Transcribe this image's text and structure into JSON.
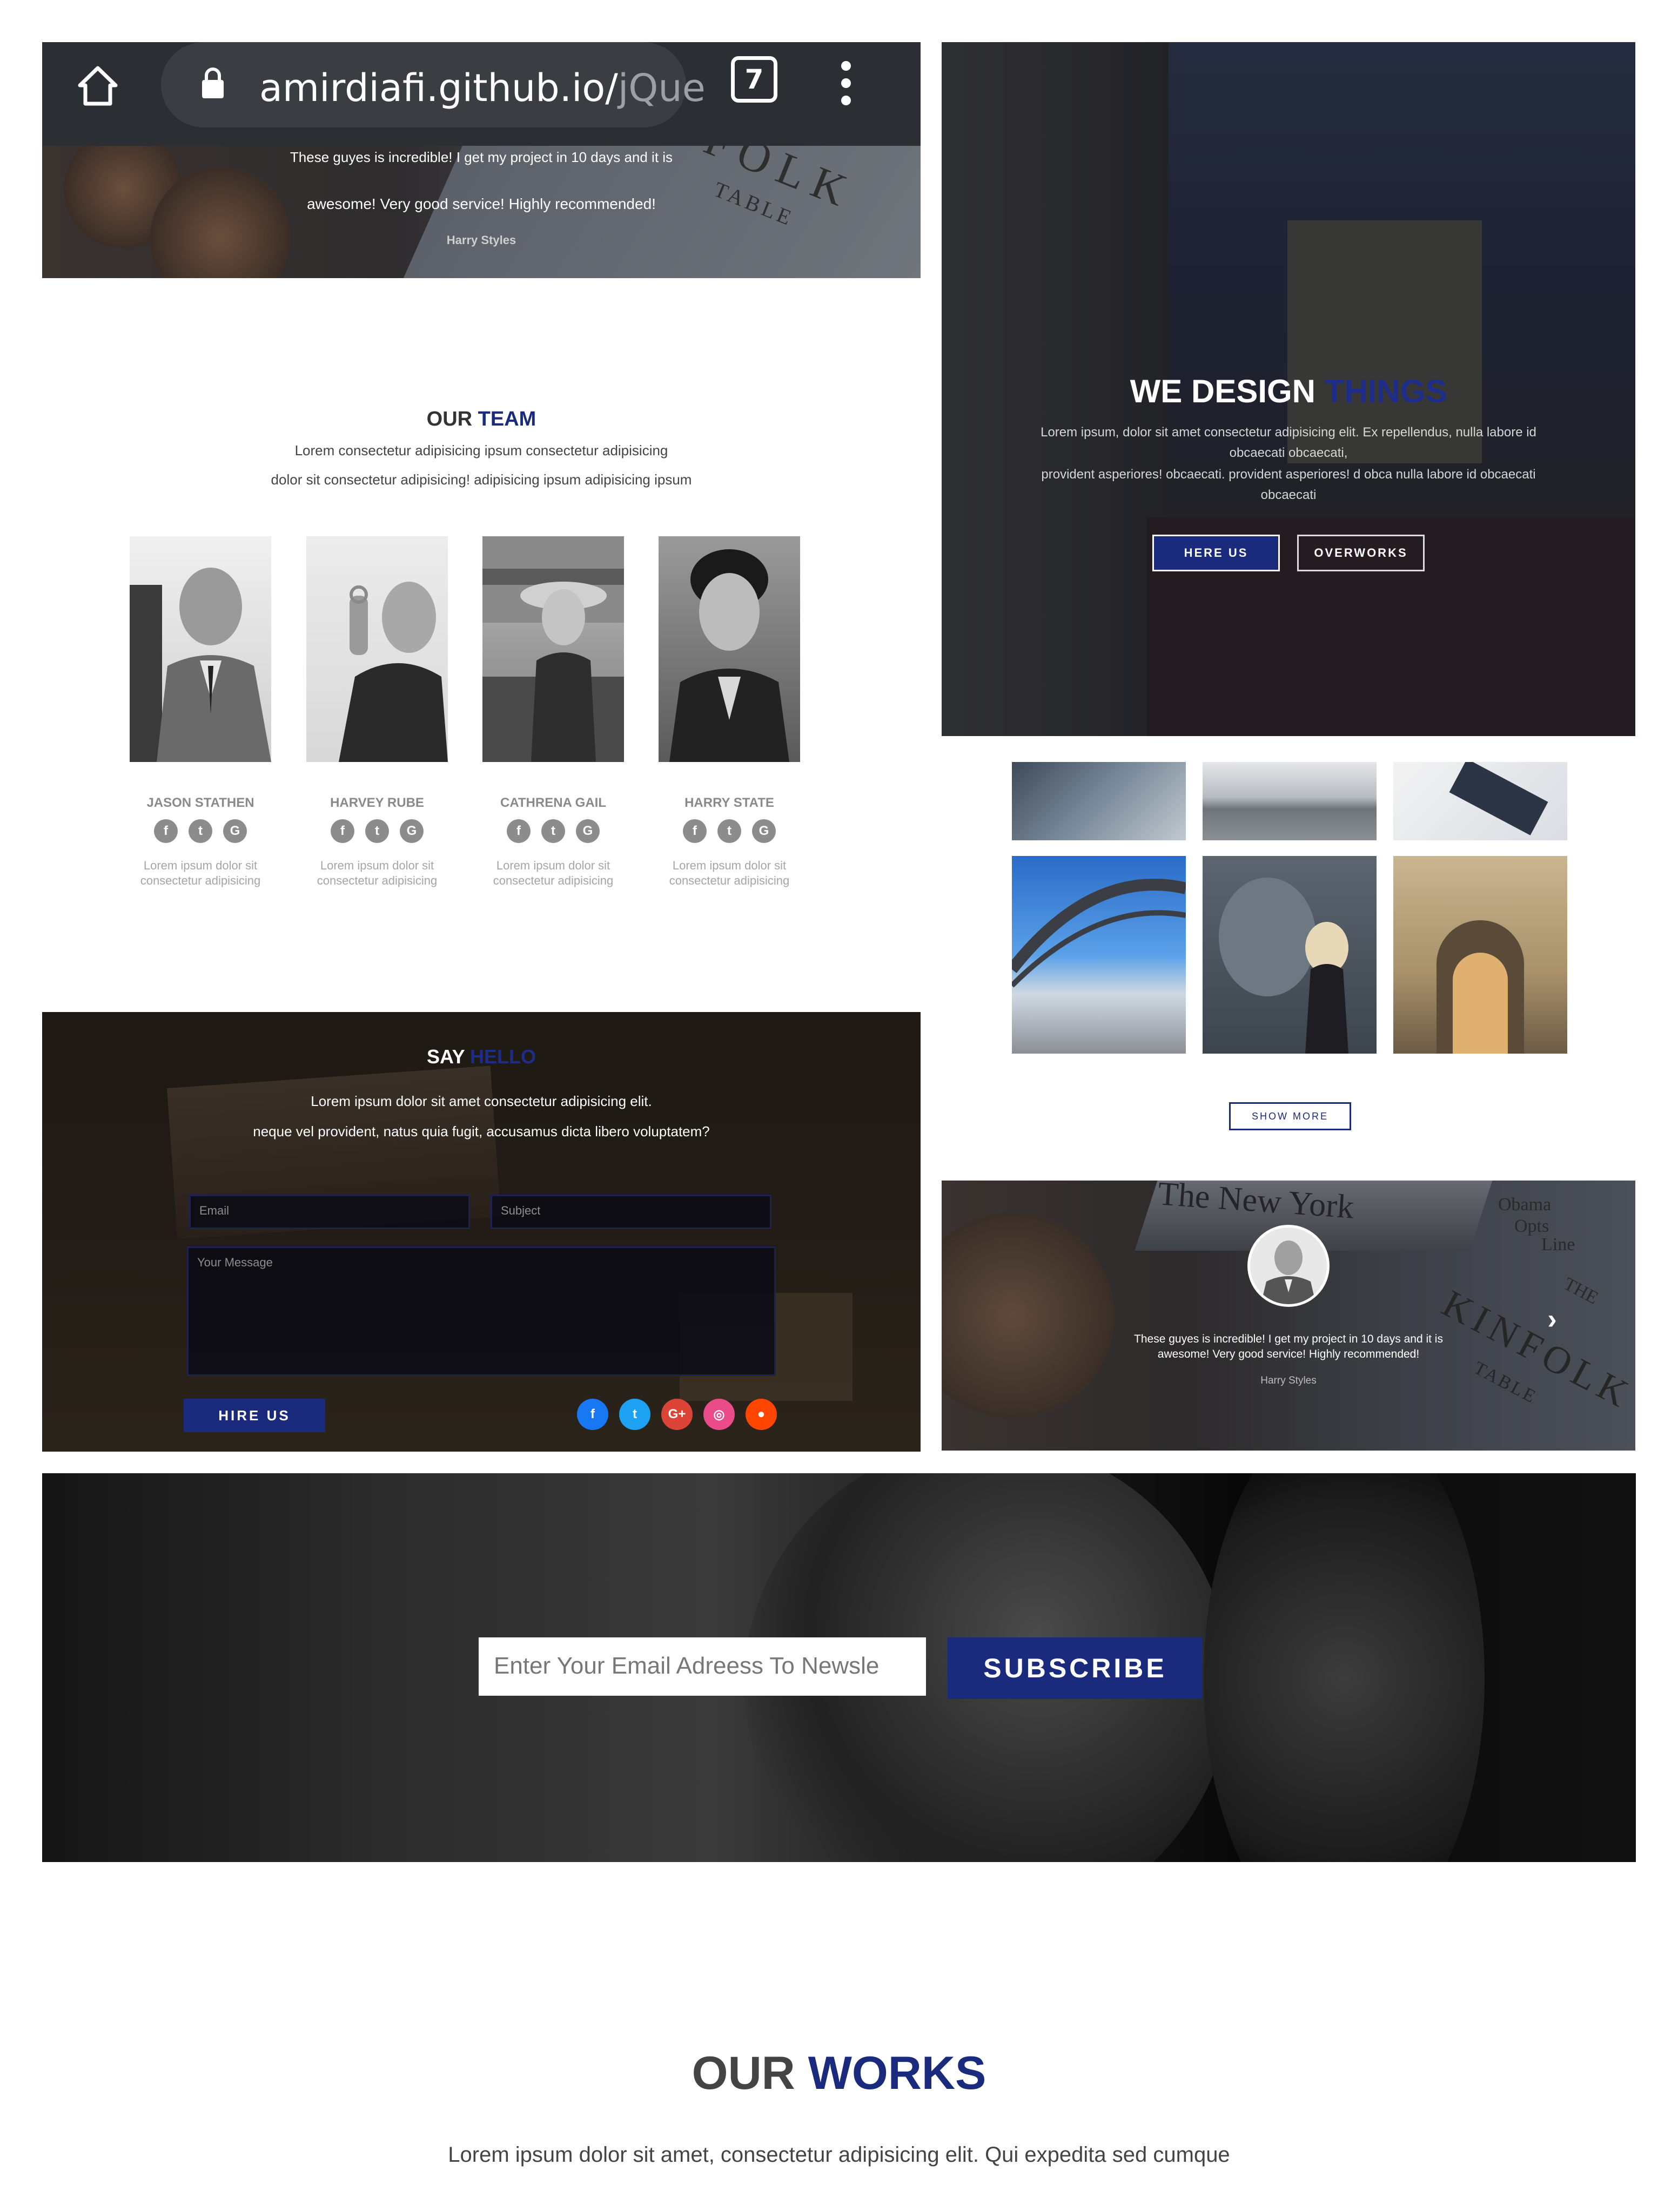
{
  "browser": {
    "url_host": "amirdiafi.github.io/",
    "url_path": "jQue",
    "tab_count": "7"
  },
  "testimonial_top": {
    "quote_partial": "These guyes is incredible! I get my project in 10 days and it is",
    "quote_line2": "awesome! Very good service! Highly recommended!",
    "author": "Harry Styles",
    "magazine_text": "FOLK",
    "magazine_text2": "TABLE"
  },
  "team": {
    "title_a": "OUR",
    "title_b": "TEAM",
    "subtitle_line1": "Lorem consectetur adipisicing ipsum consectetur adipisicing",
    "subtitle_line2": "dolor sit consectetur adipisicing! adipisicing ipsum adipisicing ipsum",
    "members": [
      {
        "name": "JASON STATHEN",
        "desc": "Lorem ipsum dolor sit consectetur adipisicing"
      },
      {
        "name": "HARVEY RUBE",
        "desc": "Lorem ipsum dolor sit consectetur adipisicing"
      },
      {
        "name": "CATHRENA GAIL",
        "desc": "Lorem ipsum dolor sit consectetur adipisicing"
      },
      {
        "name": "HARRY STATE",
        "desc": "Lorem ipsum dolor sit consectetur adipisicing"
      }
    ],
    "icon_facebook": "f",
    "icon_twitter": "t",
    "icon_google": "G",
    "dot_count": 4
  },
  "hero": {
    "title_a": "WE DESIGN",
    "title_b": "THINGS",
    "text_line1": "Lorem ipsum, dolor sit amet consectetur adipisicing elit. Ex repellendus, nulla labore id obcaecati obcaecati,",
    "text_line2": "provident asperiores! obcaecati. provident asperiores! d obca nulla labore id obcaecati obcaecati",
    "btn_primary": "HERE US",
    "btn_secondary": "OVERWORKS"
  },
  "gallery": {
    "show_more": "SHOW MORE"
  },
  "testimonial": {
    "quote_line1": "These guyes is incredible! I get my project in 10 days and it is",
    "quote_line2": "awesome! Very good service! Highly recommended!",
    "author": "Harry Styles",
    "next_icon": "›",
    "paper_title": "The New York",
    "paper_side1": "Obama",
    "paper_side2": "Opts",
    "paper_side3": "Line",
    "mag_the": "THE",
    "mag_kinfolk": "KINFOLK",
    "mag_table": "TABLE"
  },
  "contact": {
    "title_a": "SAY",
    "title_b": "HELLO",
    "text_line1": "Lorem ipsum dolor sit amet consectetur adipisicing elit.",
    "text_line2": "neque vel provident, natus quia fugit, accusamus dicta libero voluptatem?",
    "email_placeholder": "Email",
    "subject_placeholder": "Subject",
    "message_placeholder": "Your Message",
    "submit_label": "HIRE US",
    "socials": [
      {
        "glyph": "f",
        "color": "#1877f2"
      },
      {
        "glyph": "t",
        "color": "#1da1f2"
      },
      {
        "glyph": "G+",
        "color": "#db4437"
      },
      {
        "glyph": "◎",
        "color": "#ea4c89"
      },
      {
        "glyph": "●",
        "color": "#ff4500"
      }
    ]
  },
  "newsletter": {
    "email_placeholder": "Enter Your Email Adreess To Newsle",
    "subscribe_label": "SUBSCRIBE"
  },
  "works": {
    "title_a": "OUR",
    "title_b": "WORKS",
    "subtitle": "Lorem ipsum dolor sit amet, consectetur adipisicing elit. Qui expedita sed cumque"
  },
  "colors": {
    "accent_blue": "#1a2a7c",
    "dark": "#2b2e33"
  }
}
